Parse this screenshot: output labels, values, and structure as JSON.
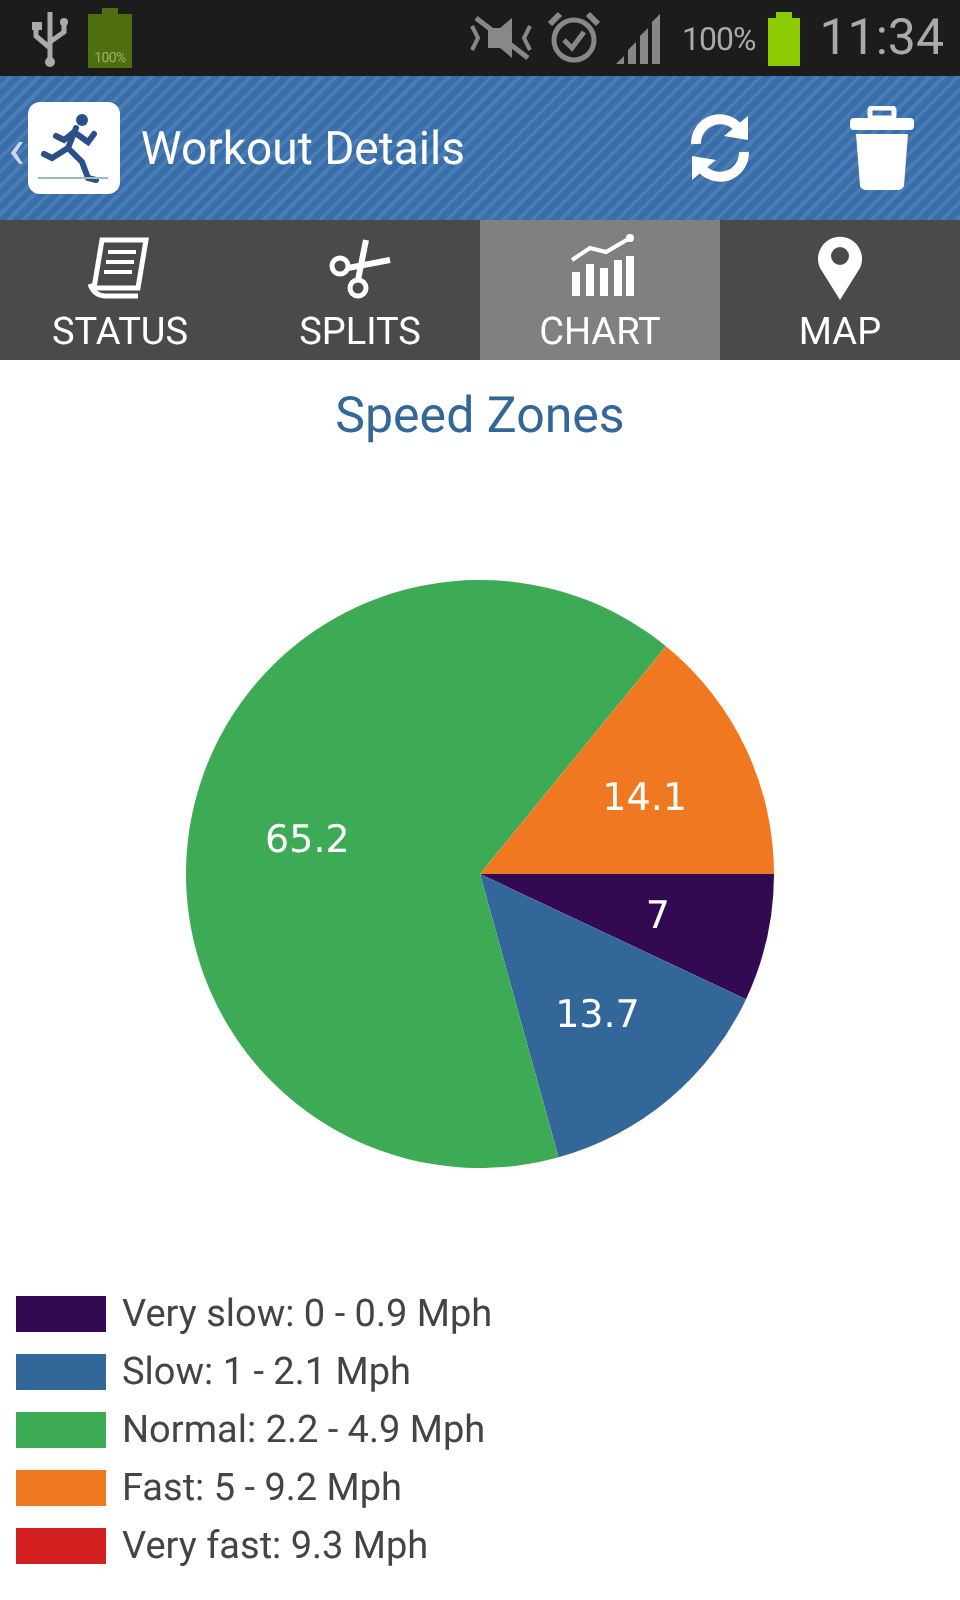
{
  "status_bar": {
    "small_battery_label": "100%",
    "battery_percent": "100%",
    "time": "11:34"
  },
  "action_bar": {
    "back": "‹",
    "title": "Workout Details"
  },
  "tabs": [
    {
      "label": "STATUS",
      "selected": false
    },
    {
      "label": "SPLITS",
      "selected": false
    },
    {
      "label": "CHART",
      "selected": true
    },
    {
      "label": "MAP",
      "selected": false
    }
  ],
  "chart": {
    "chart_data": {
      "type": "pie",
      "title": "Speed Zones",
      "categories": [
        "Very slow: 0 - 0.9 Mph",
        "Slow: 1 - 2.1 Mph",
        "Normal: 2.2 - 4.9 Mph",
        "Fast: 5 - 9.2 Mph",
        "Very fast: 9.3 Mph"
      ],
      "values": [
        7,
        13.7,
        65.2,
        14.1,
        0
      ],
      "colors": [
        "#330a52",
        "#336699",
        "#3daa55",
        "#f07820",
        "#d42020"
      ],
      "data_labels": true
    }
  }
}
